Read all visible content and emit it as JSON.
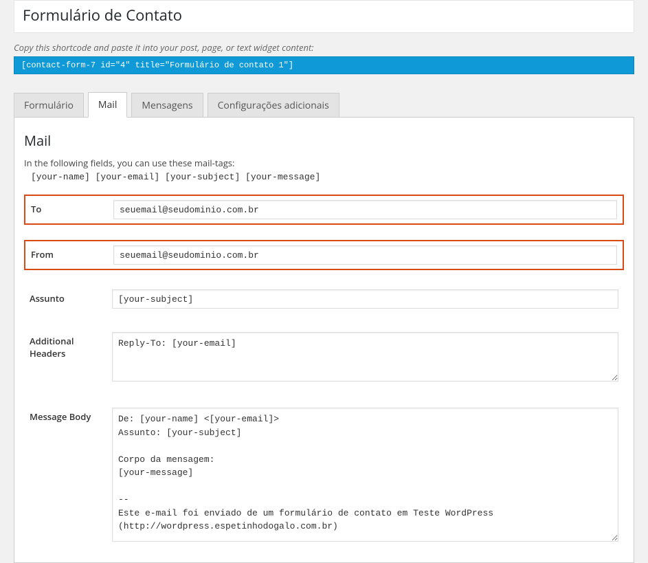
{
  "header": {
    "title": "Formulário de Contato"
  },
  "shortcode": {
    "hint": "Copy this shortcode and paste it into your post, page, or text widget content:",
    "code": "[contact-form-7 id=\"4\" title=\"Formulário de contato 1\"]"
  },
  "tabs": {
    "formulario": "Formulário",
    "mail": "Mail",
    "mensagens": "Mensagens",
    "configuracoes": "Configurações adicionais"
  },
  "mail": {
    "heading": "Mail",
    "tags_hint": "In the following fields, you can use these mail-tags:",
    "tags": "[your-name] [your-email] [your-subject] [your-message]",
    "to_label": "To",
    "to_value": "seuemail@seudominio.com.br",
    "from_label": "From",
    "from_value": "seuemail@seudominio.com.br",
    "subject_label": "Assunto",
    "subject_value": "[your-subject]",
    "headers_label": "Additional Headers",
    "headers_value": "Reply-To: [your-email]",
    "body_label": "Message Body",
    "body_value": "De: [your-name] <[your-email]>\nAssunto: [your-subject]\n\nCorpo da mensagem:\n[your-message]\n\n--\nEste e-mail foi enviado de um formulário de contato em Teste WordPress (http://wordpress.espetinhodogalo.com.br)"
  }
}
